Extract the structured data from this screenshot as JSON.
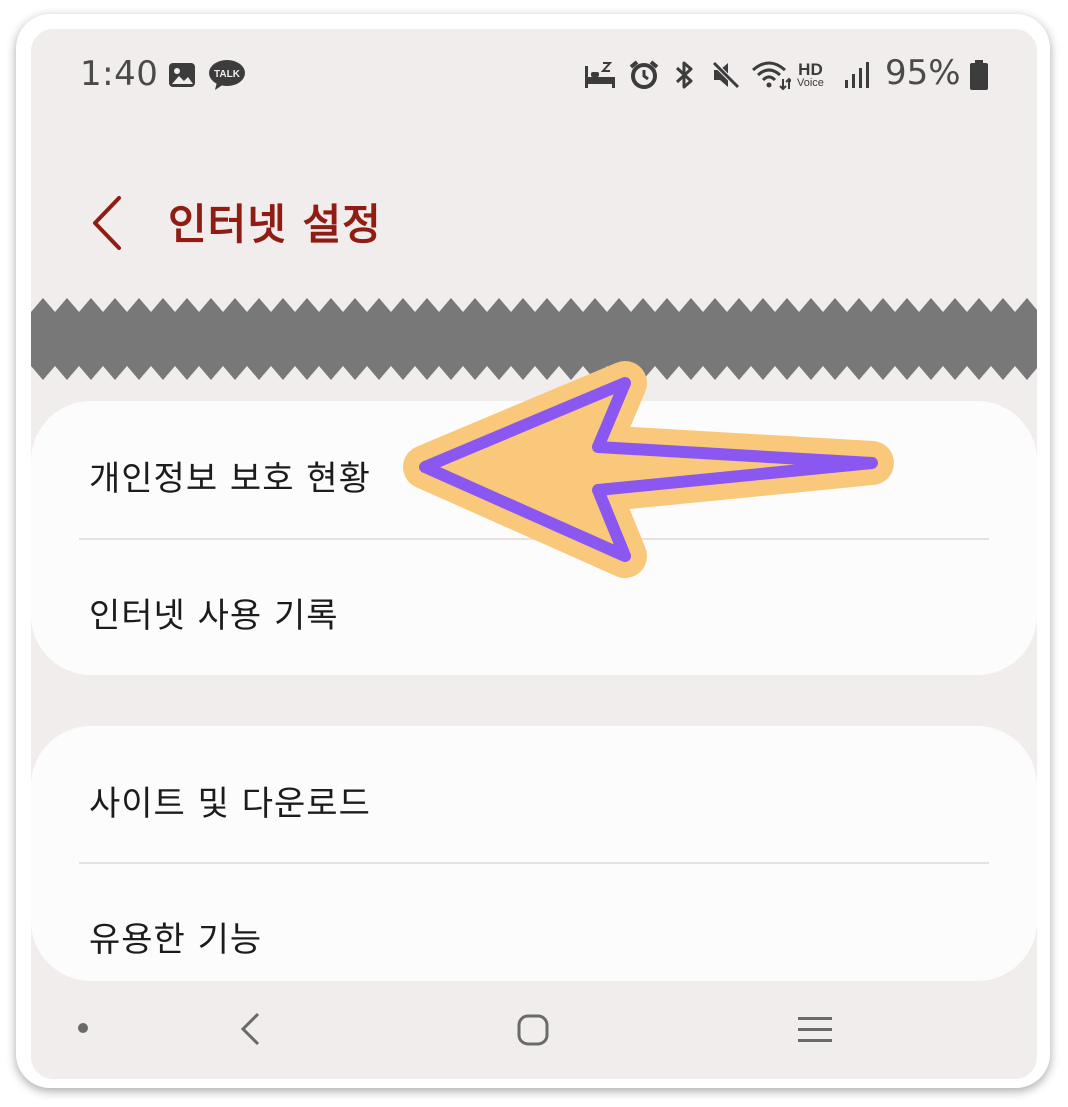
{
  "status_bar": {
    "time": "1:40",
    "battery_percent": "95%",
    "hd_label": "HD",
    "voice_label": "Voice",
    "talk_label": "TALK",
    "icons": [
      "gallery-icon",
      "kakaotalk-icon",
      "sleep-mode-icon",
      "alarm-icon",
      "bluetooth-icon",
      "mute-icon",
      "wifi-icon",
      "hd-voice-icon",
      "signal-icon",
      "battery-icon"
    ]
  },
  "header": {
    "title": "인터넷 설정"
  },
  "sections": {
    "card1": {
      "items": [
        {
          "label": "개인정보 보호 현황"
        },
        {
          "label": "인터넷 사용 기록"
        }
      ]
    },
    "card2": {
      "items": [
        {
          "label": "사이트 및 다운로드"
        },
        {
          "label": "유용한 기능"
        }
      ]
    }
  },
  "colors": {
    "title": "#8f1d14",
    "background": "#f2eded",
    "card": "#fdfcfc",
    "arrow_fill": "#f9c87a",
    "arrow_stroke": "#8a57f0"
  }
}
